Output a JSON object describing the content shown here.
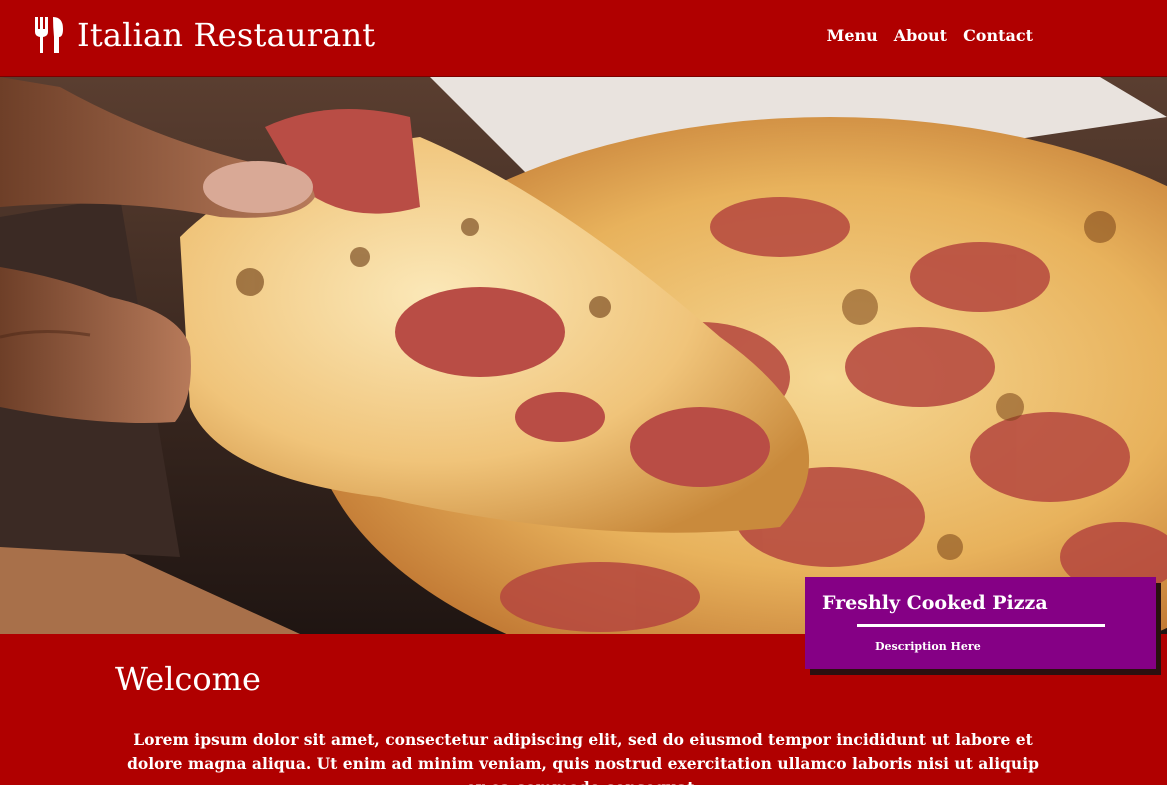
{
  "header": {
    "brand_title": "Italian Restaurant",
    "brand_icon": "fork-spoon-icon",
    "nav": [
      {
        "label": "Menu"
      },
      {
        "label": "About"
      },
      {
        "label": "Contact"
      }
    ]
  },
  "hero": {
    "image_subject": "pizza-slice-photo",
    "caption": {
      "title": "Freshly Cooked Pizza",
      "description": "Description Here"
    }
  },
  "welcome": {
    "heading": "Welcome",
    "text": "Lorem ipsum dolor sit amet, consectetur adipiscing elit, sed do eiusmod tempor incididunt ut labore et dolore magna aliqua. Ut enim ad minim veniam, quis nostrud exercitation ullamco laboris nisi ut aliquip ex ea commodo consequat."
  },
  "colors": {
    "primary_red": "#b00000",
    "caption_purple": "#850085",
    "text": "#ffffff"
  }
}
